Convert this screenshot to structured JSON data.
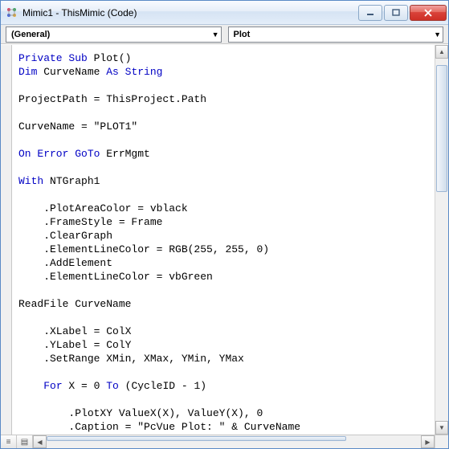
{
  "window": {
    "title": "Mimic1 - ThisMimic (Code)"
  },
  "toolbar": {
    "left_combo": "(General)",
    "right_combo": "Plot"
  },
  "code": {
    "tokens": [
      [
        [
          "kw",
          "Private Sub"
        ],
        [
          "",
          " Plot()"
        ]
      ],
      [
        [
          "kw",
          "Dim"
        ],
        [
          "",
          " CurveName "
        ],
        [
          "kw",
          "As String"
        ]
      ],
      [
        [
          "",
          ""
        ]
      ],
      [
        [
          "",
          "ProjectPath = ThisProject.Path"
        ]
      ],
      [
        [
          "",
          ""
        ]
      ],
      [
        [
          "",
          "CurveName = \"PLOT1\""
        ]
      ],
      [
        [
          "",
          ""
        ]
      ],
      [
        [
          "kw",
          "On Error GoTo"
        ],
        [
          "",
          " ErrMgmt"
        ]
      ],
      [
        [
          "",
          ""
        ]
      ],
      [
        [
          "kw",
          "With"
        ],
        [
          "",
          " NTGraph1"
        ]
      ],
      [
        [
          "",
          ""
        ]
      ],
      [
        [
          "",
          "    .PlotAreaColor = vblack"
        ]
      ],
      [
        [
          "",
          "    .FrameStyle = Frame"
        ]
      ],
      [
        [
          "",
          "    .ClearGraph"
        ]
      ],
      [
        [
          "",
          "    .ElementLineColor = RGB(255, 255, 0)"
        ]
      ],
      [
        [
          "",
          "    .AddElement"
        ]
      ],
      [
        [
          "",
          "    .ElementLineColor = vbGreen"
        ]
      ],
      [
        [
          "",
          ""
        ]
      ],
      [
        [
          "",
          "ReadFile CurveName"
        ]
      ],
      [
        [
          "",
          ""
        ]
      ],
      [
        [
          "",
          "    .XLabel = ColX"
        ]
      ],
      [
        [
          "",
          "    .YLabel = ColY"
        ]
      ],
      [
        [
          "",
          "    .SetRange XMin, XMax, YMin, YMax"
        ]
      ],
      [
        [
          "",
          ""
        ]
      ],
      [
        [
          "",
          "    "
        ],
        [
          "kw",
          "For"
        ],
        [
          "",
          " X = 0 "
        ],
        [
          "kw",
          "To"
        ],
        [
          "",
          " (CycleID - 1)"
        ]
      ],
      [
        [
          "",
          ""
        ]
      ],
      [
        [
          "",
          "        .PlotXY ValueX(X), ValueY(X), 0"
        ]
      ],
      [
        [
          "",
          "        .Caption = \"PcVue Plot: \" & CurveName"
        ]
      ]
    ]
  }
}
